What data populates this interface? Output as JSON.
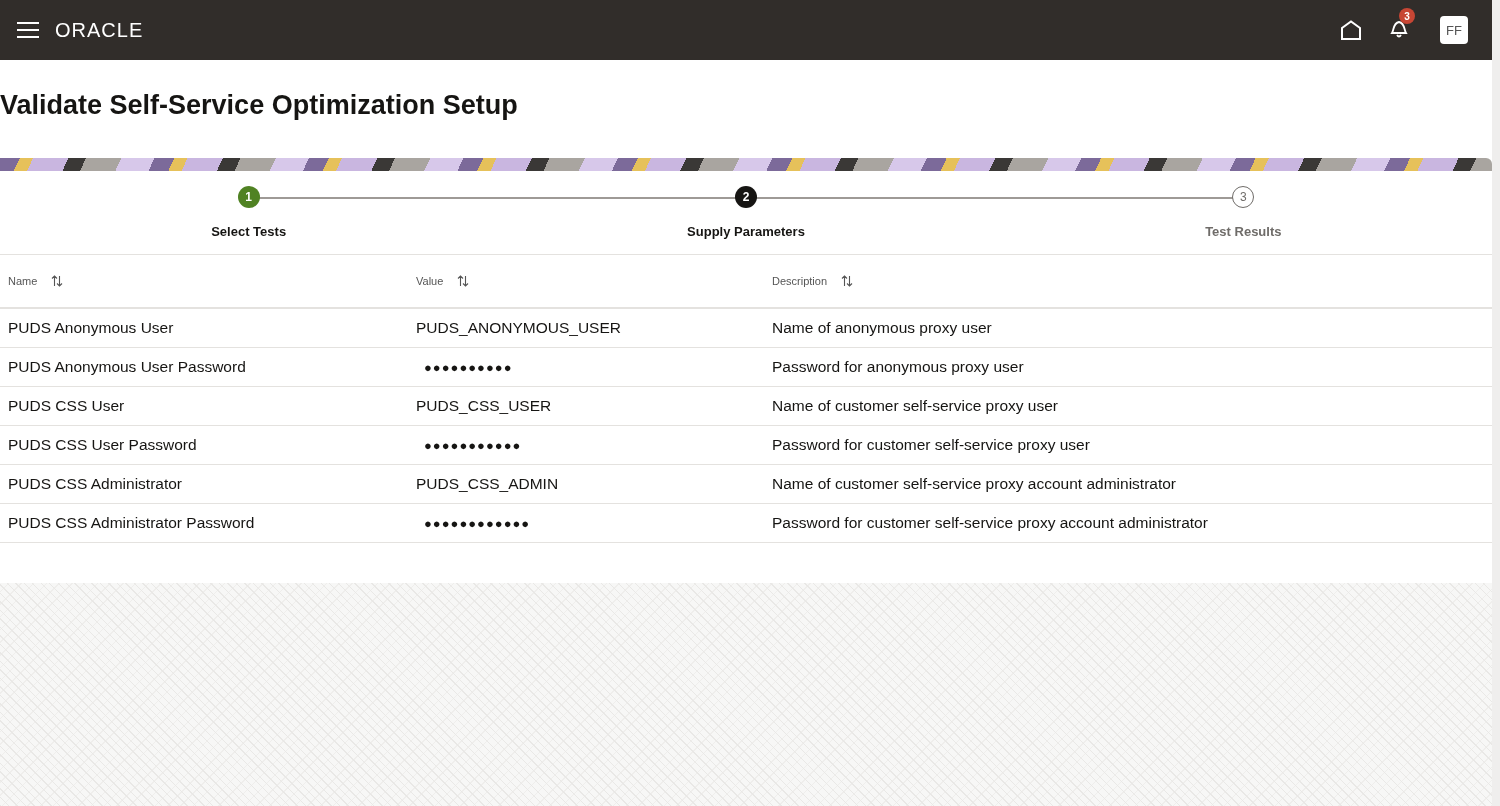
{
  "header": {
    "logo": "ORACLE",
    "notification_count": "3",
    "avatar_initials": "FF"
  },
  "page_title": "Validate Self-Service Optimization Setup",
  "steps": [
    {
      "number": "1",
      "label": "Select Tests",
      "kind": "completed"
    },
    {
      "number": "2",
      "label": "Supply Parameters",
      "kind": "current"
    },
    {
      "number": "3",
      "label": "Test Results",
      "kind": "pending"
    }
  ],
  "table": {
    "columns": [
      "Name",
      "Value",
      "Description"
    ],
    "rows": [
      {
        "name": "PUDS Anonymous User",
        "value": "PUDS_ANONYMOUS_USER",
        "kind": "text",
        "description": "Name of anonymous proxy user"
      },
      {
        "name": "PUDS Anonymous User Password",
        "value": "●●●●●●●●●●",
        "kind": "password",
        "description": "Password for anonymous proxy user"
      },
      {
        "name": "PUDS CSS User",
        "value": "PUDS_CSS_USER",
        "kind": "text",
        "description": "Name of customer self-service proxy user"
      },
      {
        "name": "PUDS CSS User Password",
        "value": "●●●●●●●●●●●",
        "kind": "password",
        "description": "Password for customer self-service proxy user"
      },
      {
        "name": "PUDS CSS Administrator",
        "value": "PUDS_CSS_ADMIN",
        "kind": "text",
        "description": "Name of customer self-service proxy account administrator"
      },
      {
        "name": "PUDS CSS Administrator Password",
        "value": "●●●●●●●●●●●●",
        "kind": "password",
        "description": "Password for customer self-service proxy account administrator"
      }
    ]
  }
}
